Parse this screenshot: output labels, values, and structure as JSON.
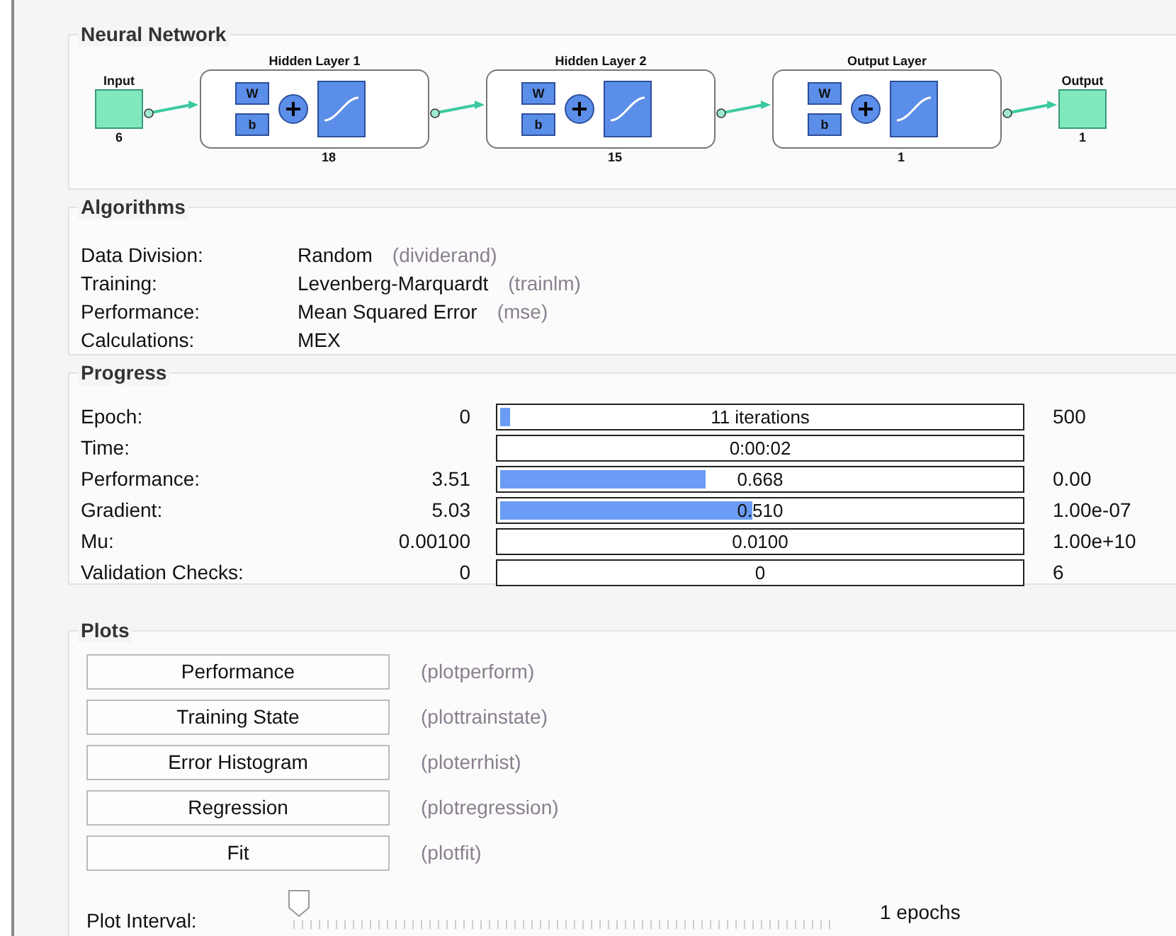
{
  "network": {
    "title": "Neural Network",
    "input": {
      "label": "Input",
      "size": "6"
    },
    "layers": [
      {
        "title": "Hidden Layer 1",
        "weight": "W",
        "bias": "b",
        "size": "18"
      },
      {
        "title": "Hidden Layer 2",
        "weight": "W",
        "bias": "b",
        "size": "15"
      },
      {
        "title": "Output Layer",
        "weight": "W",
        "bias": "b",
        "size": "1"
      }
    ],
    "output": {
      "label": "Output",
      "size": "1"
    }
  },
  "algorithms": {
    "title": "Algorithms",
    "rows": [
      {
        "label": "Data Division:",
        "value": "Random",
        "function": "(dividerand)"
      },
      {
        "label": "Training:",
        "value": "Levenberg-Marquardt",
        "function": "(trainlm)"
      },
      {
        "label": "Performance:",
        "value": "Mean Squared Error",
        "function": "(mse)"
      },
      {
        "label": "Calculations:",
        "value": "MEX"
      }
    ]
  },
  "progress": {
    "title": "Progress",
    "rows": [
      {
        "label": "Epoch:",
        "start": "0",
        "reading": "11 iterations",
        "level": 0.02,
        "end": "500"
      },
      {
        "label": "Time:",
        "reading": "0:00:02"
      },
      {
        "label": "Performance:",
        "start": "3.51",
        "reading": "0.668",
        "level": 0.39,
        "end": "0.00"
      },
      {
        "label": "Gradient:",
        "start": "5.03",
        "reading": "0.510",
        "level": 0.48,
        "end": "1.00e-07"
      },
      {
        "label": "Mu:",
        "start": "0.00100",
        "reading": "0.0100",
        "end": "1.00e+10"
      },
      {
        "label": "Validation Checks:",
        "start": "0",
        "reading": "0",
        "end": "6"
      }
    ]
  },
  "plots": {
    "title": "Plots",
    "buttons": [
      {
        "label": "Performance",
        "function": "(plotperform)"
      },
      {
        "label": "Training State",
        "function": "(plottrainstate)"
      },
      {
        "label": "Error Histogram",
        "function": "(ploterrhist)"
      },
      {
        "label": "Regression",
        "function": "(plotregression)"
      },
      {
        "label": "Fit",
        "function": "(plotfit)"
      }
    ],
    "interval": {
      "label": "Plot Interval:",
      "level": 0,
      "reading": "1 epochs"
    }
  }
}
